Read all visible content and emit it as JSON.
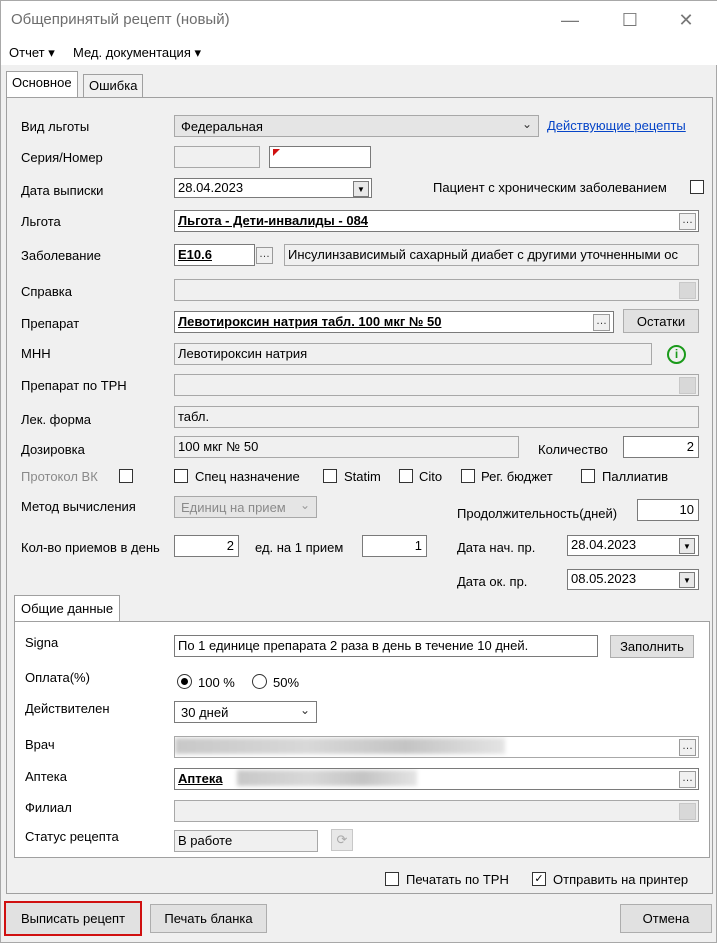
{
  "window": {
    "title": "Общепринятый рецепт (новый)"
  },
  "menu": {
    "report": "Отчет ▾",
    "med_docs": "Мед. документация ▾"
  },
  "tabs": {
    "main": "Основное",
    "error": "Ошибка"
  },
  "benefit_type": {
    "label": "Вид льготы",
    "value": "Федеральная",
    "link": "Действующие рецепты"
  },
  "series": {
    "label": "Серия/Номер",
    "series": "",
    "number": ""
  },
  "issue_date": {
    "label": "Дата выписки",
    "value": "28.04.2023"
  },
  "chronic": {
    "label": "Пациент с хроническим заболеванием",
    "checked": false
  },
  "benefit": {
    "label": "Льгота",
    "value": "Льгота - Дети-инвалиды - 084"
  },
  "disease": {
    "label": "Заболевание",
    "code": "E10.6",
    "name": "Инсулинзависимый сахарный диабет с другими уточненными ос"
  },
  "certificate": {
    "label": "Справка",
    "value": ""
  },
  "drug": {
    "label": "Препарат",
    "value": "Левотироксин натрия табл. 100 мкг № 50",
    "remains_button": "Остатки"
  },
  "inn": {
    "label": "МНН",
    "value": "Левотироксин натрия"
  },
  "drug_trn": {
    "label": "Препарат по ТРН",
    "value": ""
  },
  "form": {
    "label": "Лек. форма",
    "value": "табл."
  },
  "dosage": {
    "label": "Дозировка",
    "value": "100 мкг № 50"
  },
  "quantity": {
    "label": "Количество",
    "value": "2"
  },
  "checkboxes": {
    "vk": "Протокол ВК",
    "special": "Спец назначение",
    "statim": "Statim",
    "cito": "Cito",
    "reg_budget": "Рег. бюджет",
    "palliative": "Паллиатив"
  },
  "calc_method": {
    "label": "Метод вычисления",
    "value": "Единиц на прием"
  },
  "duration": {
    "label": "Продолжительность(дней)",
    "value": "10"
  },
  "doses_per_day": {
    "label": "Кол-во приемов в день",
    "value": "2"
  },
  "units_per_dose": {
    "label": "ед. на 1 прием",
    "value": "1"
  },
  "start_date": {
    "label": "Дата нач. пр.",
    "value": "28.04.2023"
  },
  "end_date": {
    "label": "Дата ок. пр.",
    "value": "08.05.2023"
  },
  "general_tab": "Общие данные",
  "signa": {
    "label": "Signa",
    "value": "По 1 единице препарата 2 раза в день в течение 10 дней.",
    "fill_button": "Заполнить"
  },
  "payment": {
    "label": "Оплата(%)",
    "opt100": "100 %",
    "opt50": "50%",
    "selected": "100 %"
  },
  "valid": {
    "label": "Действителен",
    "value": "30 дней"
  },
  "doctor": {
    "label": "Врач"
  },
  "pharmacy": {
    "label": "Аптека",
    "value": "Аптека"
  },
  "branch": {
    "label": "Филиал"
  },
  "status": {
    "label": "Статус рецепта",
    "value": "В работе"
  },
  "print_trn": {
    "label": "Печатать по ТРН",
    "checked": false
  },
  "send_printer": {
    "label": "Отправить на принтер",
    "checked": true
  },
  "footer": {
    "issue": "Выписать рецепт",
    "print_blank": "Печать бланка",
    "cancel": "Отмена"
  },
  "colors": {
    "accent_red": "#d01010",
    "link_blue": "#0645c8",
    "info_green": "#1a9a1a"
  }
}
